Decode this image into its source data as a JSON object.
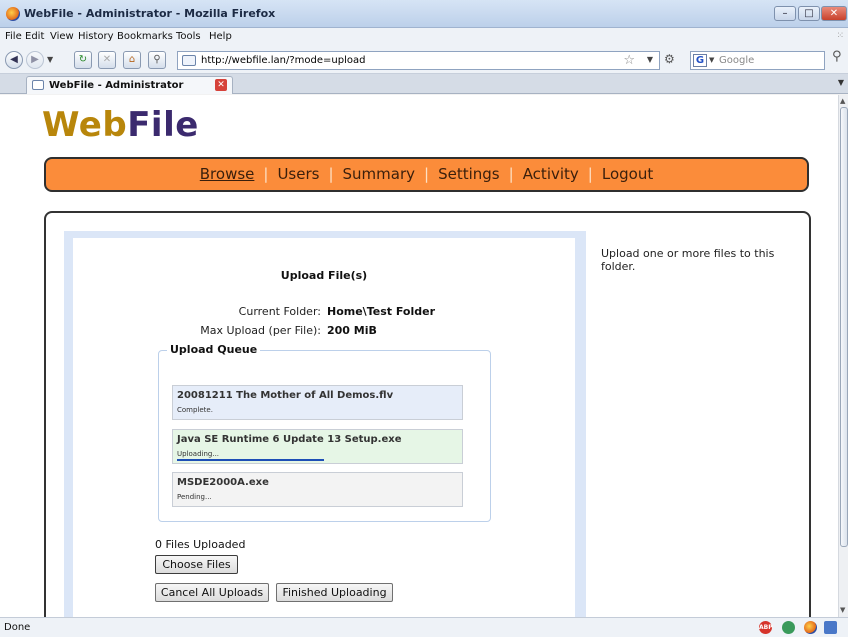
{
  "window": {
    "title": "WebFile - Administrator - Mozilla Firefox",
    "controls": [
      "–",
      "□",
      "✕"
    ]
  },
  "menubar": [
    "File",
    "Edit",
    "View",
    "History",
    "Bookmarks",
    "Tools",
    "Help"
  ],
  "navbar": {
    "url": "http://webfile.lan/?mode=upload",
    "search_placeholder": "Google",
    "google_letter": "G"
  },
  "tab": {
    "label": "WebFile - Administrator",
    "close": "✕"
  },
  "page": {
    "logo_part1": "Web",
    "logo_part2": "File",
    "logo_colors": {
      "web": "#b8860b",
      "file": "#3b2a6e"
    },
    "nav": [
      {
        "label": "Browse",
        "active": true
      },
      {
        "label": "Users",
        "active": false
      },
      {
        "label": "Summary",
        "active": false
      },
      {
        "label": "Settings",
        "active": false
      },
      {
        "label": "Activity",
        "active": false
      },
      {
        "label": "Logout",
        "active": false
      }
    ],
    "nav_separator": "|",
    "upload": {
      "title": "Upload File(s)",
      "current_folder_label": "Current Folder:",
      "current_folder_value": "Home\\Test Folder",
      "max_upload_label": "Max Upload (per File):",
      "max_upload_value": "200 MiB",
      "queue_title": "Upload Queue",
      "queue": [
        {
          "name": "20081211 The Mother of All Demos.flv",
          "status": "Complete.",
          "state": "complete"
        },
        {
          "name": "Java SE Runtime 6 Update 13 Setup.exe",
          "status": "Uploading...",
          "state": "uploading",
          "progress": 0.52
        },
        {
          "name": "MSDE2000A.exe",
          "status": "Pending...",
          "state": "pending"
        }
      ],
      "files_uploaded": "0 Files Uploaded",
      "choose_files": "Choose Files",
      "cancel_all": "Cancel All Uploads",
      "finished": "Finished Uploading"
    },
    "side_help": "Upload one or more files to this folder."
  },
  "statusbar": {
    "text": "Done",
    "adblock": "ABP"
  },
  "colors": {
    "nav_bar": "#fb8c3a",
    "queue_complete": "#e6edf9",
    "queue_uploading": "#e6f6e6",
    "queue_pending": "#f3f3f3",
    "progress": "#1d4fb6"
  }
}
